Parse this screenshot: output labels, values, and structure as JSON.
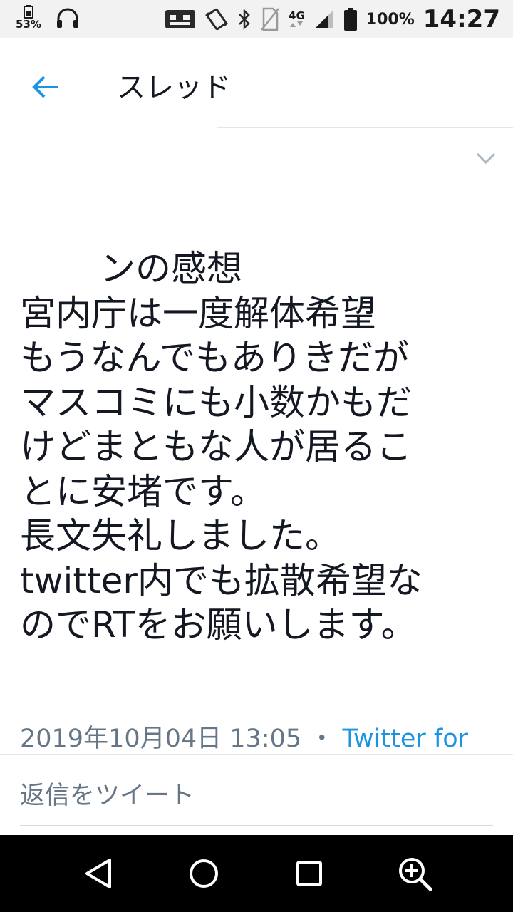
{
  "status_bar": {
    "battery_small": "53%",
    "network": "4G",
    "battery": "100%",
    "time": "14:27"
  },
  "header": {
    "title": "スレッド"
  },
  "tweet": {
    "lines": [
      "ンの感想",
      "宮内庁は一度解体希望",
      "もうなんでもありきだが",
      "マスコミにも小数かもだ",
      "けどまともな人が居るこ",
      "とに安堵です。",
      "長文失礼しました。",
      "twitter内でも拡散希望な",
      "のでRTをお願いします。"
    ],
    "timestamp": "2019年10月04日 13:05",
    "separator": "・",
    "source": "Twitter for"
  },
  "reply": {
    "placeholder": "返信をツイート"
  },
  "colors": {
    "accent": "#1b95e0",
    "muted": "#657786",
    "text": "#141823",
    "divider": "#e1e8ed"
  }
}
